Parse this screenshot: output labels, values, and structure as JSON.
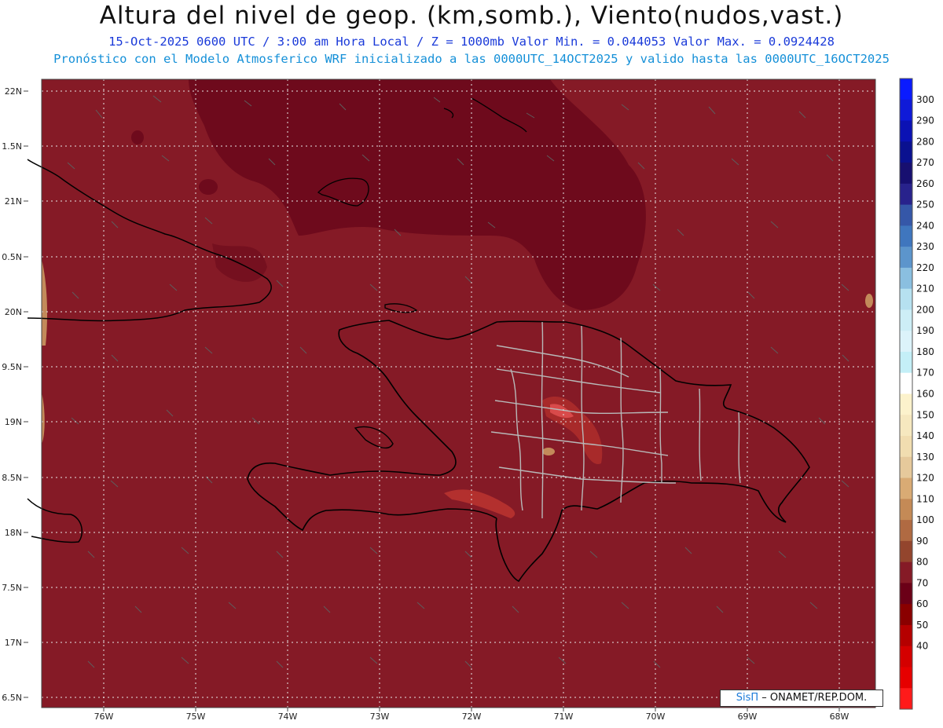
{
  "header": {
    "title": "Altura del nivel de geop. (km,somb.), Viento(nudos,vast.)",
    "line1": "15-Oct-2025  0600 UTC / 3:00 am Hora Local / Z = 1000mb  Valor Min. = 0.044053  Valor Max. = 0.0924428",
    "line2": "Pronóstico con el Modelo Atmosferico WRF inicializado a las 0000UTC_14OCT2025 y valido hasta las  0000UTC_16OCT2025"
  },
  "axes": {
    "lat_labels": [
      "22N",
      "1.5N",
      "21N",
      "0.5N",
      "20N",
      "9.5N",
      "19N",
      "8.5N",
      "18N",
      "7.5N",
      "17N",
      "6.5N"
    ],
    "lon_labels": [
      "76W",
      "75W",
      "74W",
      "73W",
      "72W",
      "71W",
      "70W",
      "69W",
      "68W"
    ]
  },
  "colorbar": {
    "labels": [
      "300",
      "290",
      "280",
      "270",
      "260",
      "250",
      "240",
      "230",
      "220",
      "210",
      "200",
      "190",
      "180",
      "170",
      "160",
      "150",
      "140",
      "130",
      "120",
      "110",
      "100",
      "90",
      "80",
      "70",
      "60",
      "50",
      "40"
    ],
    "colors": [
      "#0a1bff",
      "#0f1ad8",
      "#0b12b4",
      "#0a1190",
      "#170f70",
      "#28228c",
      "#3557a8",
      "#3f76be",
      "#5c95cc",
      "#8abfe0",
      "#b6e1f0",
      "#cdeef6",
      "#dcf3fa",
      "#c4eff7",
      "#ffffff",
      "#fcf2cc",
      "#f6e8bf",
      "#f1ddb0",
      "#e6c99b",
      "#d9ab74",
      "#c48a56",
      "#b06a42",
      "#93452d",
      "#851a26",
      "#6b0017",
      "#8a0000",
      "#b50000",
      "#d40000",
      "#e60000",
      "#ff1a1a"
    ]
  },
  "credit": {
    "brand": "SisΠ",
    "text": " – ONAMET/REP.DOM."
  }
}
